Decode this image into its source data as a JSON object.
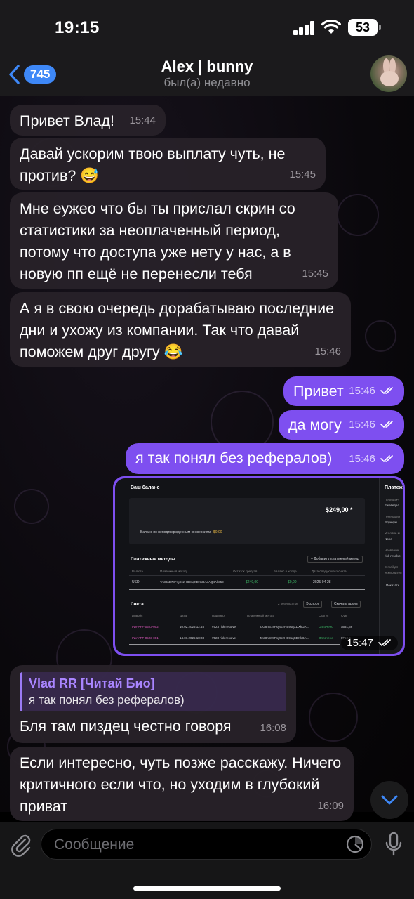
{
  "status": {
    "time": "19:15",
    "battery": "53"
  },
  "header": {
    "back_count": "745",
    "title": "Alex | bunny",
    "subtitle": "был(а) недавно"
  },
  "messages": [
    {
      "text": "Привет Влад!",
      "time": "15:44"
    },
    {
      "text": "Давай ускорим твою выплату чуть, не против? 😅",
      "time": "15:45"
    },
    {
      "text": "Мне еужео что бы ты прислал скрин со статистики за неоплаченный период, потому что доступа уже нету у нас, а в новую пп ещё не перенесли тебя",
      "time": "15:45"
    },
    {
      "text": "А я в свою очередь дорабатываю последние дни и ухожу из компании. Так что давай поможем друг другу 😂",
      "time": "15:46"
    }
  ],
  "outgoing": [
    {
      "text": "Привет",
      "time": "15:46"
    },
    {
      "text": "да могу",
      "time": "15:46"
    },
    {
      "text": "я так понял без рефералов)",
      "time": "15:46"
    }
  ],
  "image_message": {
    "time": "15:47",
    "screenshot": {
      "balance_title": "Ваш баланс",
      "balance_amount": "$249,00 *",
      "balance_note": "Баланс по неподтвержденным конверсиям:",
      "balance_note_value": "$0,00",
      "side_title": "Платеж",
      "side_items": [
        "Периодич",
        "Ежеведел",
        "Генерация",
        "Вручную",
        "Условие м",
        "None",
        "Название",
        "risk resolve",
        "E-mail дл",
        "исключител",
        "Показать"
      ],
      "methods_title": "Платежные методы",
      "add_method": "+ Добавить платежный метод",
      "methods_headers": [
        "Валюта",
        "Платежный метод",
        "Остаток средств",
        "Баланс в холде",
        "Дата следующего счета"
      ],
      "methods_row": [
        "USD",
        "TA38nB78Fsy9czHB9sqXDXkDAoAQ4Ak359",
        "$249,00",
        "$0,00",
        "2025-04-28"
      ],
      "invoices_title": "Счета",
      "invoices_count": "2 результатов",
      "export_btn": "Экспорт",
      "download_btn": "Скачать архив",
      "inv_headers": [
        "Инвойс",
        "Дата",
        "Партнер",
        "Платежный метод",
        "Статус",
        "Сум"
      ],
      "inv_rows": [
        [
          "INV-AFF-0523-002",
          "10.02.2025 12:45",
          "#523 risk resolve",
          "TA38nB78Fsy9czHB9sqXDXkDA...",
          "Оплачено",
          "$631,36"
        ],
        [
          "INV-AFF-0523-001",
          "14.01.2025 18:03",
          "#523 risk resolve",
          "TA38nB78Fsy9czHB9sqXDXkDA...",
          "Оплачено",
          "$710,6"
        ]
      ]
    }
  },
  "reply": {
    "quote_name": "Vlad RR [Читай Био]",
    "quote_text": "я так понял без рефералов)",
    "text": "Бля там пиздец честно говоря",
    "time": "16:08"
  },
  "last_message": {
    "text": "Если интересно, чуть позже расскажу. Ничего критичного если что, но уходим в глубокий приват",
    "time": "16:09"
  },
  "input": {
    "placeholder": "Сообщение"
  },
  "colors": {
    "accent": "#7e4ff0",
    "incoming": "#282129",
    "link": "#3e88f7"
  }
}
